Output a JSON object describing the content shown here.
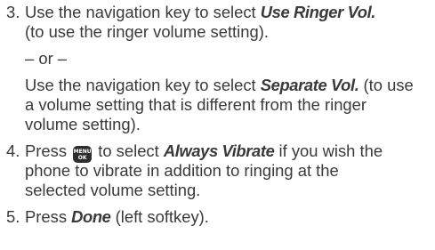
{
  "steps": [
    {
      "number": "3.",
      "line1_pre": "Use the navigation key to select ",
      "line1_em": "Use Ringer Vol.",
      "line2": "(to use the ringer volume setting).",
      "or_text": "– or –",
      "line3_pre": "Use the navigation key to select ",
      "line3_em": "Separate Vol.",
      "line3_post": " (to use",
      "line4": "a volume setting that is different from the ringer",
      "line5": "volume setting)."
    },
    {
      "number": "4.",
      "line1_pre": "Press ",
      "key_label_top": "MENU",
      "key_label_bottom": "OK",
      "line1_mid": " to select ",
      "line1_em": "Always Vibrate",
      "line1_post": " if you wish the",
      "line2": "phone to vibrate in addition to ringing at the",
      "line3": "selected volume setting."
    },
    {
      "number": "5.",
      "line1_pre": "Press ",
      "line1_em": "Done",
      "line1_post": " (left softkey)."
    }
  ]
}
